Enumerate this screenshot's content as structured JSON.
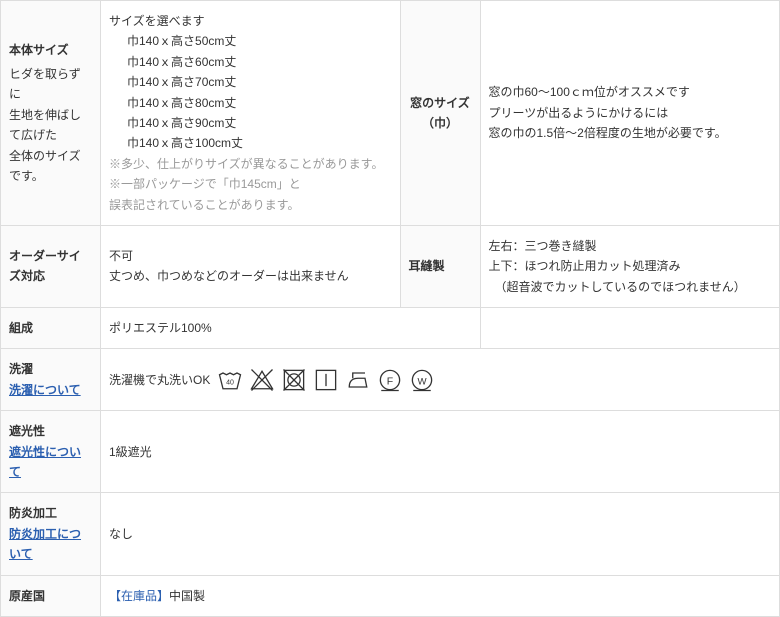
{
  "row1": {
    "th1_title": "本体サイズ",
    "th1_sub": "ヒダを取らずに\n生地を伸ばして広げた\n全体のサイズです。",
    "sizes_title": "サイズを選べます",
    "sizes": [
      "巾140ｘ高さ50cm丈",
      "巾140ｘ高さ60cm丈",
      "巾140ｘ高さ70cm丈",
      "巾140ｘ高さ80cm丈",
      "巾140ｘ高さ90cm丈",
      "巾140ｘ高さ100cm丈"
    ],
    "note1": "※多少、仕上がりサイズが異なることがあります。",
    "note2": "※一部パッケージで「巾145cm」と\n誤表記されていることがあります。",
    "th2_line1": "窓のサイズ",
    "th2_line2": "（巾）",
    "window_text": "窓の巾60～100ｃｍ位がオススメです\nプリーツが出るようにかけるには\n窓の巾の1.5倍～2倍程度の生地が必要です。"
  },
  "row2": {
    "th1": "オーダーサイズ対応",
    "td1_line1": "不可",
    "td1_line2": "丈つめ、巾つめなどのオーダーは出来ません",
    "th2": "耳縫製",
    "td2": "左右：三つ巻き縫製\n上下：ほつれ防止用カット処理済み\n　（超音波でカットしているのでほつれません）"
  },
  "row3": {
    "th": "組成",
    "td": "ポリエステル100%"
  },
  "row4": {
    "th_title": "洗濯",
    "th_link": "洗濯について",
    "td_text": "洗濯機で丸洗いOK",
    "icons": [
      "wash-40",
      "no-bleach",
      "no-tumble",
      "dry-flat",
      "iron",
      "dryclean-f",
      "wetclean-w"
    ]
  },
  "row5": {
    "th_title": "遮光性",
    "th_link": "遮光性について",
    "td": "1級遮光"
  },
  "row6": {
    "th_title": "防炎加工",
    "th_link": "防炎加工について",
    "td": "なし"
  },
  "row7": {
    "th": "原産国",
    "stock": "【在庫品】",
    "country": "中国製"
  }
}
